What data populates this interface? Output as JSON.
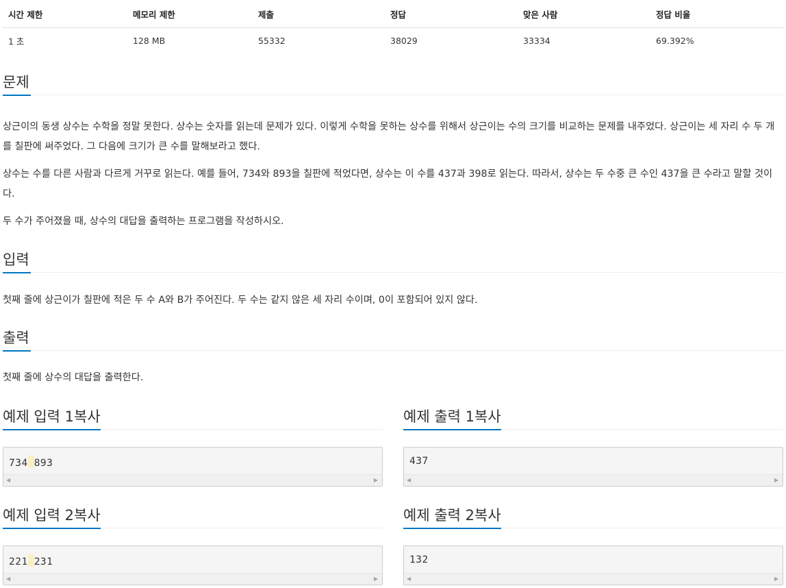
{
  "stats": {
    "headers": [
      "시간 제한",
      "메모리 제한",
      "제출",
      "정답",
      "맞은 사람",
      "정답 비율"
    ],
    "values": [
      "1 초",
      "128 MB",
      "55332",
      "38029",
      "33334",
      "69.392%"
    ]
  },
  "problem": {
    "title": "문제",
    "paragraphs": [
      "상근이의 동생 상수는 수학을 정말 못한다. 상수는 숫자를 읽는데 문제가 있다. 이렇게 수학을 못하는 상수를 위해서 상근이는 수의 크기를 비교하는 문제를 내주었다. 상근이는 세 자리 수 두 개를 칠판에 써주었다. 그 다음에 크기가 큰 수를 말해보라고 했다.",
      "상수는 수를 다른 사람과 다르게 거꾸로 읽는다. 예를 들어, 734와 893을 칠판에 적었다면, 상수는 이 수를 437과 398로 읽는다. 따라서, 상수는 두 수중 큰 수인 437을 큰 수라고 말할 것이다.",
      "두 수가 주어졌을 때, 상수의 대답을 출력하는 프로그램을 작성하시오."
    ]
  },
  "input": {
    "title": "입력",
    "text": "첫째 줄에 상근이가 칠판에 적은 두 수 A와 B가 주어진다. 두 수는 같지 않은 세 자리 수이며, 0이 포함되어 있지 않다."
  },
  "output": {
    "title": "출력",
    "text": "첫째 줄에 상수의 대답을 출력한다."
  },
  "copy_label": "복사",
  "samples": [
    {
      "input_title": "예제 입력 1",
      "output_title": "예제 출력 1",
      "input_a": "734",
      "input_b": "893",
      "output": "437"
    },
    {
      "input_title": "예제 입력 2",
      "output_title": "예제 출력 2",
      "input_a": "221",
      "input_b": "231",
      "output": "132"
    }
  ],
  "colors": {
    "accent": "#0076c0",
    "code_bg": "#f5f5f5",
    "space_highlight": "#f9efc4"
  }
}
